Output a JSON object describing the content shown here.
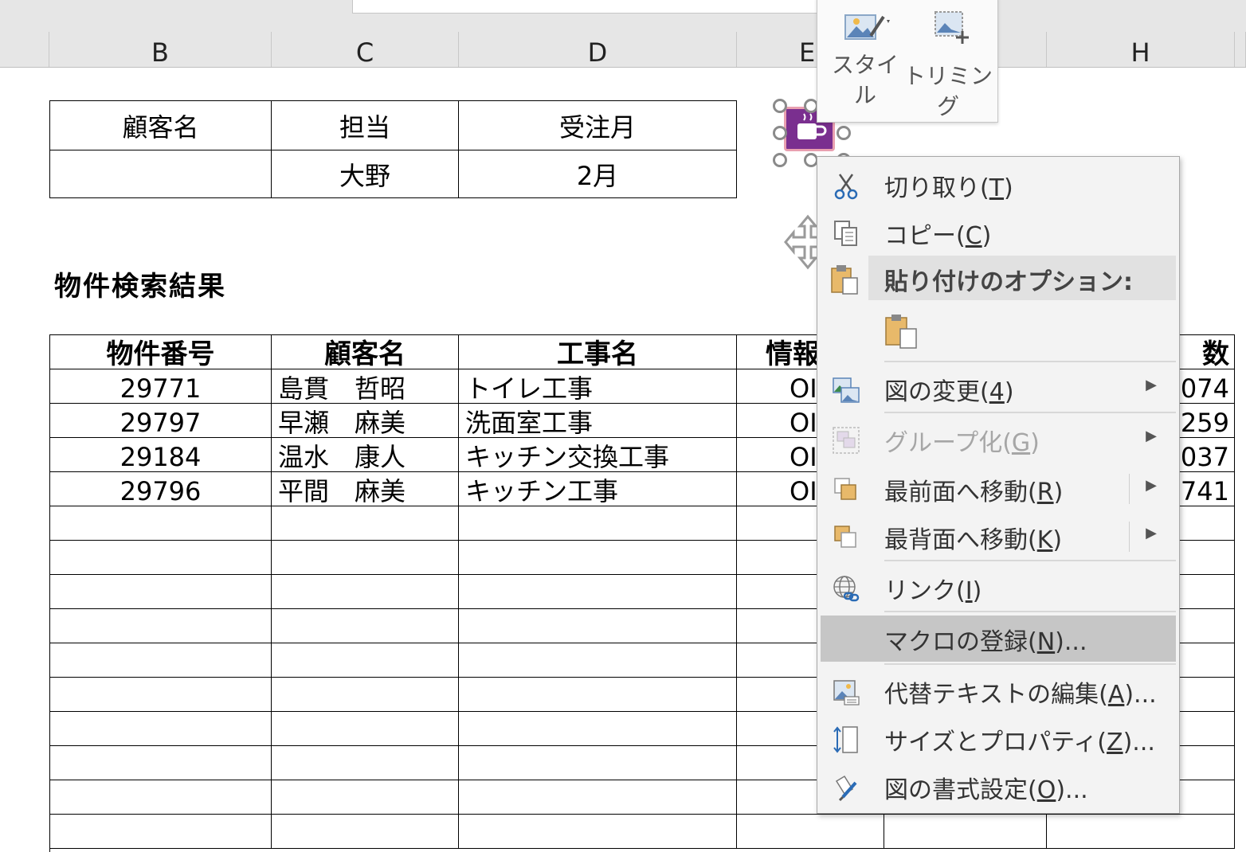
{
  "columns": [
    {
      "letter": "B"
    },
    {
      "letter": "C"
    },
    {
      "letter": "D"
    },
    {
      "letter": "E"
    },
    {
      "letter": "H"
    }
  ],
  "info_table": {
    "headers": [
      "顧客名",
      "担当",
      "受注月"
    ],
    "values": [
      "",
      "大野",
      "2月"
    ]
  },
  "section_title": "物件検索結果",
  "results": {
    "headers": [
      "物件番号",
      "顧客名",
      "工事名",
      "情報",
      "数"
    ],
    "rows": [
      {
        "id": "29771",
        "customer": "島貫　哲昭",
        "work": "トイレ工事",
        "info": "OI",
        "tail": "074"
      },
      {
        "id": "29797",
        "customer": "早瀬　麻美",
        "work": "洗面室工事",
        "info": "OI",
        "tail": "259"
      },
      {
        "id": "29184",
        "customer": "温水　康人",
        "work": "キッチン交換工事",
        "info": "OI",
        "tail": "037"
      },
      {
        "id": "29796",
        "customer": "平間　麻美",
        "work": "キッチン工事",
        "info": "OI",
        "tail": "741"
      }
    ]
  },
  "mini_toolbar": {
    "style_line1": "スタイ",
    "style_line2": "ル",
    "crop_label": "トリミング"
  },
  "context_menu": {
    "cut": {
      "pre": "切り取り(",
      "key": "T",
      "post": ")"
    },
    "copy": {
      "pre": "コピー(",
      "key": "C",
      "post": ")"
    },
    "paste_options": "貼り付けのオプション:",
    "change_picture": {
      "pre": "図の変更(",
      "key": "4",
      "post": ")"
    },
    "group": {
      "pre": "グループ化(",
      "key": "G",
      "post": ")"
    },
    "bring_front": {
      "pre": "最前面へ移動(",
      "key": "R",
      "post": ")"
    },
    "send_back": {
      "pre": "最背面へ移動(",
      "key": "K",
      "post": ")"
    },
    "link": {
      "pre": "リンク(",
      "key": "I",
      "post": ")"
    },
    "assign_macro": {
      "pre": "マクロの登録(",
      "key": "N",
      "post": ")..."
    },
    "alt_text": {
      "pre": "代替テキストの編集(",
      "key": "A",
      "post": ")..."
    },
    "size_props": {
      "pre": "サイズとプロパティ(",
      "key": "Z",
      "post": ")..."
    },
    "format_picture": {
      "pre": "図の書式設定(",
      "key": "O",
      "post": ")..."
    }
  },
  "colors": {
    "highlight": "#c6c6c6",
    "picture": "#7a2f8f",
    "menu_bg": "#f3f3f3"
  }
}
